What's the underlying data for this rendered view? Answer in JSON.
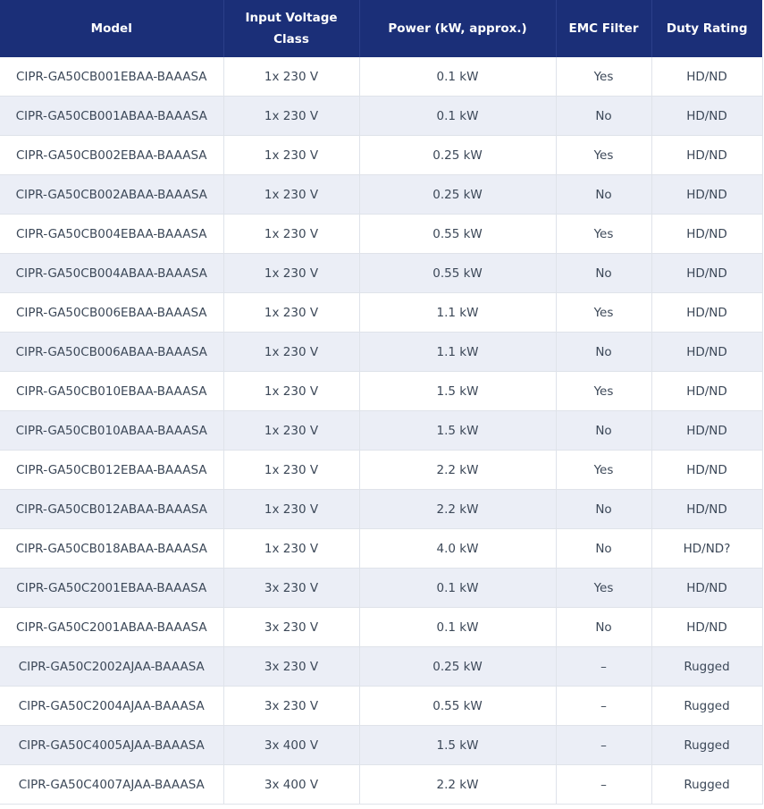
{
  "table": {
    "headers": [
      "Model",
      "Input Voltage Class",
      "Power (kW, approx.)",
      "EMC Filter",
      "Duty Rating"
    ],
    "rows": [
      [
        "CIPR-GA50CB001EBAA-BAAASA",
        "1x 230 V",
        "0.1 kW",
        "Yes",
        "HD/ND"
      ],
      [
        "CIPR-GA50CB001ABAA-BAAASA",
        "1x 230 V",
        "0.1 kW",
        "No",
        "HD/ND"
      ],
      [
        "CIPR-GA50CB002EBAA-BAAASA",
        "1x 230 V",
        "0.25 kW",
        "Yes",
        "HD/ND"
      ],
      [
        "CIPR-GA50CB002ABAA-BAAASA",
        "1x 230 V",
        "0.25 kW",
        "No",
        "HD/ND"
      ],
      [
        "CIPR-GA50CB004EBAA-BAAASA",
        "1x 230 V",
        "0.55 kW",
        "Yes",
        "HD/ND"
      ],
      [
        "CIPR-GA50CB004ABAA-BAAASA",
        "1x 230 V",
        "0.55 kW",
        "No",
        "HD/ND"
      ],
      [
        "CIPR-GA50CB006EBAA-BAAASA",
        "1x 230 V",
        "1.1 kW",
        "Yes",
        "HD/ND"
      ],
      [
        "CIPR-GA50CB006ABAA-BAAASA",
        "1x 230 V",
        "1.1 kW",
        "No",
        "HD/ND"
      ],
      [
        "CIPR-GA50CB010EBAA-BAAASA",
        "1x 230 V",
        "1.5 kW",
        "Yes",
        "HD/ND"
      ],
      [
        "CIPR-GA50CB010ABAA-BAAASA",
        "1x 230 V",
        "1.5 kW",
        "No",
        "HD/ND"
      ],
      [
        "CIPR-GA50CB012EBAA-BAAASA",
        "1x 230 V",
        "2.2 kW",
        "Yes",
        "HD/ND"
      ],
      [
        "CIPR-GA50CB012ABAA-BAAASA",
        "1x 230 V",
        "2.2 kW",
        "No",
        "HD/ND"
      ],
      [
        "CIPR-GA50CB018ABAA-BAAASA",
        "1x 230 V",
        "4.0 kW",
        "No",
        "HD/ND?"
      ],
      [
        "CIPR-GA50C2001EBAA-BAAASA",
        "3x 230 V",
        "0.1 kW",
        "Yes",
        "HD/ND"
      ],
      [
        "CIPR-GA50C2001ABAA-BAAASA",
        "3x 230 V",
        "0.1 kW",
        "No",
        "HD/ND"
      ],
      [
        "CIPR-GA50C2002AJAA-BAAASA",
        "3x 230 V",
        "0.25 kW",
        "–",
        "Rugged"
      ],
      [
        "CIPR-GA50C2004AJAA-BAAASA",
        "3x 230 V",
        "0.55 kW",
        "–",
        "Rugged"
      ],
      [
        "CIPR-GA50C4005AJAA-BAAASA",
        "3x 400 V",
        "1.5 kW",
        "–",
        "Rugged"
      ],
      [
        "CIPR-GA50C4007AJAA-BAAASA",
        "3x 400 V",
        "2.2 kW",
        "–",
        "Rugged"
      ]
    ]
  },
  "colors": {
    "header_bg": "#1b2f78",
    "header_text": "#ffffff",
    "row_alt_bg": "#ebeef6",
    "cell_text": "#3c4858",
    "border": "#dfe3ea"
  }
}
